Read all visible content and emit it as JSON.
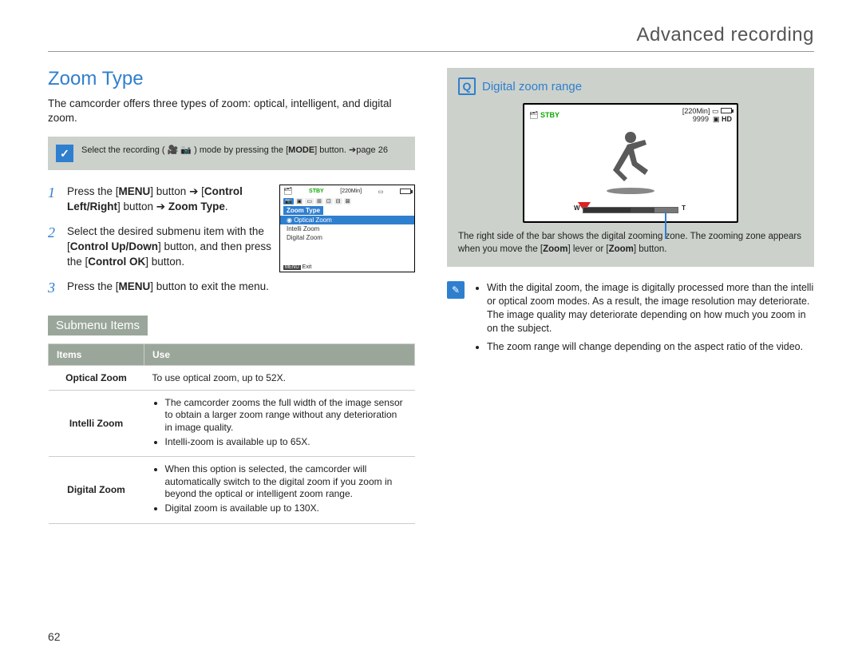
{
  "header": {
    "chapter_title": "Advanced recording"
  },
  "page_number": "62",
  "left": {
    "title": "Zoom Type",
    "intro": "The camcorder offers three types of zoom: optical, intelligent, and digital zoom.",
    "prereq": {
      "before": "Select the recording (",
      "after": ") mode by pressing the [",
      "mode": "MODE",
      "tail": "] button. ➔page 26"
    },
    "steps": [
      {
        "num": "1",
        "html": "Press the [<b>MENU</b>] button ➔ [<b>Control Left/Right</b>] button ➔ <b>Zoom Type</b>."
      },
      {
        "num": "2",
        "html": "Select the desired submenu item with the [<b>Control Up/Down</b>] button, and then press the [<b>Control OK</b>] button."
      },
      {
        "num": "3",
        "html": "Press the [<b>MENU</b>] button to exit the menu."
      }
    ],
    "screenshot": {
      "stby": "STBY",
      "time": "[220Min]",
      "section_label": "Zoom Type",
      "menu_items": [
        "Optical Zoom",
        "Intelli Zoom",
        "Digital Zoom"
      ],
      "exit_btn": "MENU",
      "exit_label": "Exit"
    },
    "submenu_title": "Submenu Items",
    "table": {
      "headers": [
        "Items",
        "Use"
      ],
      "rows": [
        {
          "item": "Optical Zoom",
          "use_text": "To use optical zoom, up to 52X."
        },
        {
          "item": "Intelli Zoom",
          "use_bullets": [
            "The camcorder zooms the full width of the image sensor to obtain a larger zoom range without any deterioration in image quality.",
            "Intelli-zoom is available up to 65X."
          ]
        },
        {
          "item": "Digital Zoom",
          "use_bullets": [
            "When this option is selected, the camcorder will automatically switch to the digital zoom if you zoom in beyond the optical or intelligent zoom range.",
            "Digital zoom is available up to 130X."
          ]
        }
      ]
    }
  },
  "right": {
    "panel_title": "Digital zoom range",
    "screen": {
      "stby": "STBY",
      "time": "[220Min]",
      "count": "9999",
      "hd": "HD",
      "bar_w": "W",
      "bar_t": "T"
    },
    "caption": "The right side of the bar shows the digital zooming zone. The zooming zone appears when you move the [Zoom] lever or [Zoom] button.",
    "notes": [
      "With the digital zoom, the image is digitally processed more than the intelli or optical zoom modes. As a result, the image resolution may deteriorate. The image quality may deteriorate depending on how much you zoom in on the subject.",
      "The zoom range will change depending on the aspect ratio of the video."
    ]
  }
}
